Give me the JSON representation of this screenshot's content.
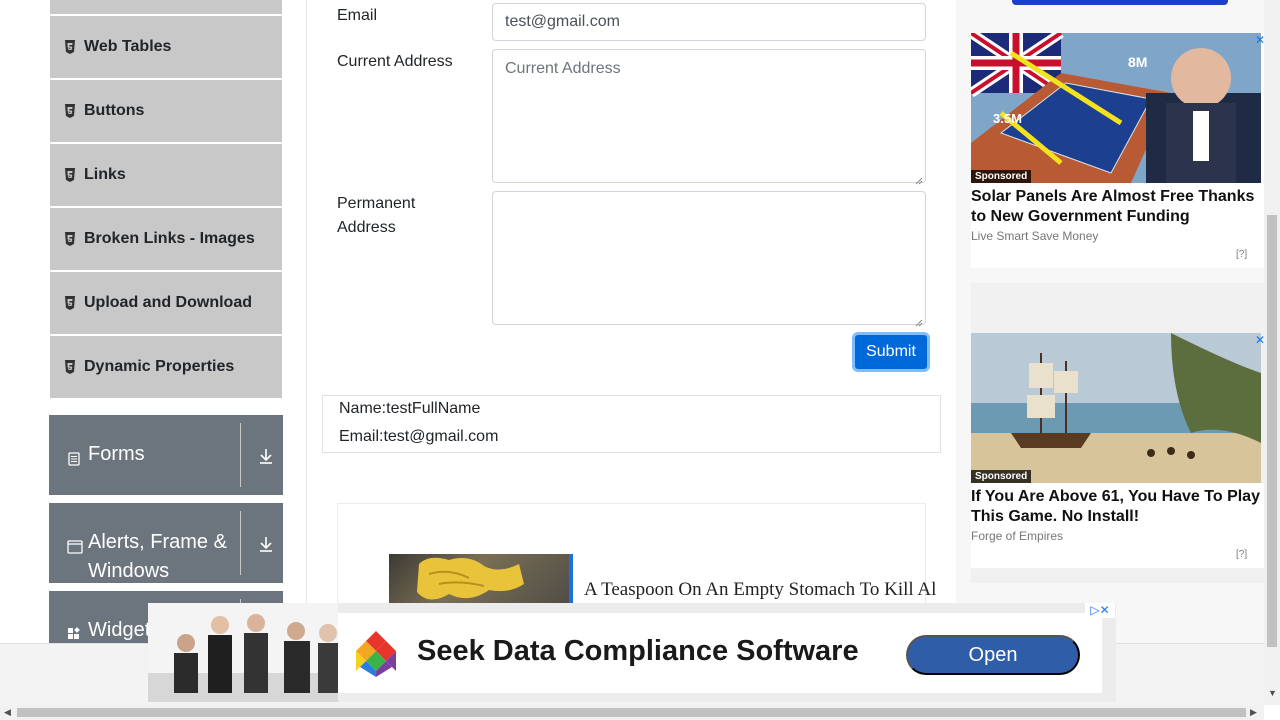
{
  "sidebar": {
    "items": [
      {
        "label": "Web Tables"
      },
      {
        "label": "Buttons"
      },
      {
        "label": "Links"
      },
      {
        "label": "Broken Links - Images"
      },
      {
        "label": "Upload and Download"
      },
      {
        "label": "Dynamic Properties"
      }
    ],
    "groups": [
      {
        "label": "Forms"
      },
      {
        "label": "Alerts, Frame &",
        "label2": "Windows"
      },
      {
        "label": "Widgets"
      }
    ]
  },
  "form": {
    "email_label": "Email",
    "email_value": "test@gmail.com",
    "current_address_label": "Current Address",
    "current_address_placeholder": "Current Address",
    "permanent_address_label_1": "Permanent",
    "permanent_address_label_2": "Address",
    "submit_label": "Submit"
  },
  "output": {
    "name": "Name:testFullName",
    "email": "Email:test@gmail.com"
  },
  "inline_ad": {
    "headline": "A Teaspoon On An Empty Stomach To Kill Al"
  },
  "right_ads": [
    {
      "badge": "Sponsored",
      "title": "Solar Panels Are Almost Free Thanks to New Government Funding",
      "source": "Live Smart Save Money",
      "img_text_1": "8M",
      "img_text_2": "3.5M"
    },
    {
      "badge": "Sponsored",
      "title": "If You Are Above 61, You Have To Play This Game. No Install!",
      "source": "Forge of Empires"
    }
  ],
  "ad_info": "[?]",
  "banner": {
    "title": "Seek Data Compliance Software",
    "button": "Open"
  },
  "colors": {
    "sidebar_item_bg": "#c8c8c8",
    "group_bg": "#6c757d",
    "submit_bg": "#0069d9",
    "open_btn_bg": "#2f5da7"
  }
}
